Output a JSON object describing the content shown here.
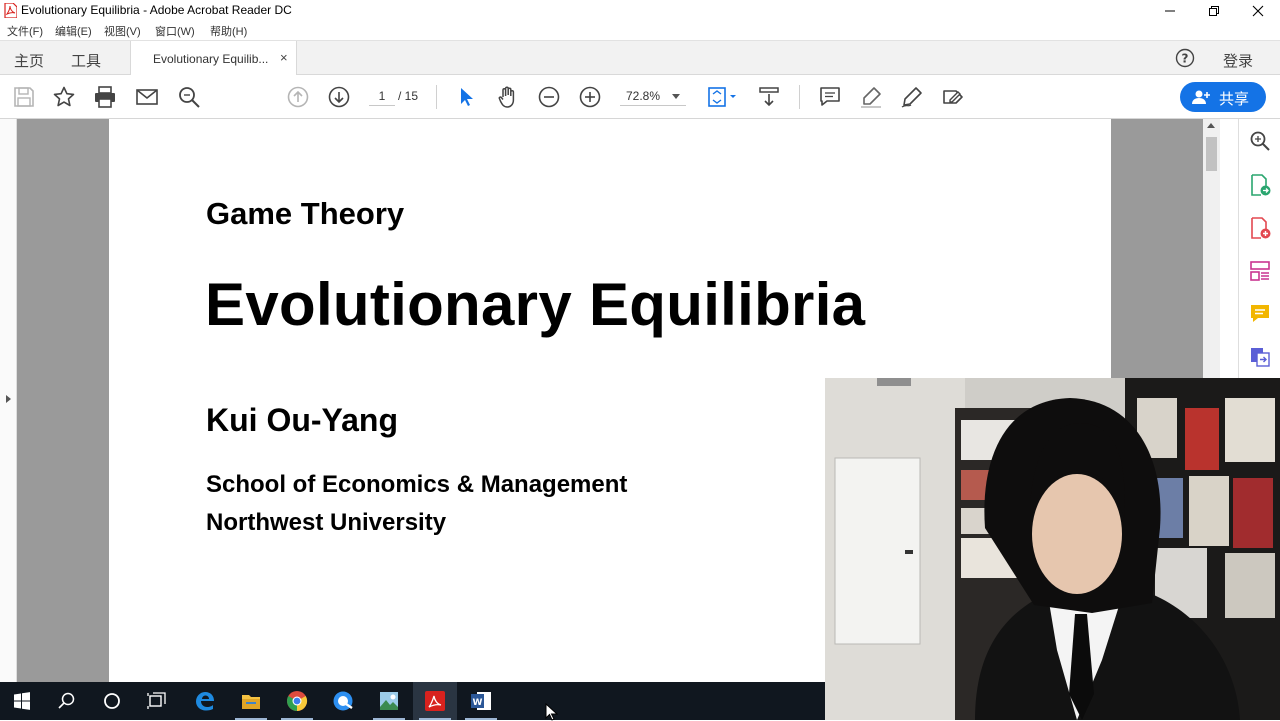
{
  "window": {
    "title": "Evolutionary Equilibria - Adobe Acrobat Reader DC"
  },
  "menu": {
    "items": [
      "文件(F)",
      "编辑(E)",
      "视图(V)",
      "窗口(W)",
      "帮助(H)"
    ]
  },
  "tabs": {
    "home": "主页",
    "tools": "工具",
    "document": "Evolutionary Equilib...",
    "close": "×",
    "help": "?",
    "login": "登录"
  },
  "toolbar": {
    "current_page": "1",
    "total_pages": "/ 15",
    "zoom": "72.8%",
    "share_label": "共享",
    "accent_color": "#1473e6"
  },
  "document": {
    "course": "Game Theory",
    "title": "Evolutionary Equilibria",
    "author": "Kui Ou-Yang",
    "affiliation_1": "School of Economics & Management",
    "affiliation_2": "Northwest University"
  },
  "taskbar": {
    "apps": [
      "start-icon",
      "search-icon",
      "cortana-icon",
      "task-view-icon",
      "edge-icon",
      "file-explorer-icon",
      "chrome-icon",
      "qq-browser-icon",
      "picture-app-icon",
      "acrobat-icon",
      "word-icon"
    ]
  }
}
